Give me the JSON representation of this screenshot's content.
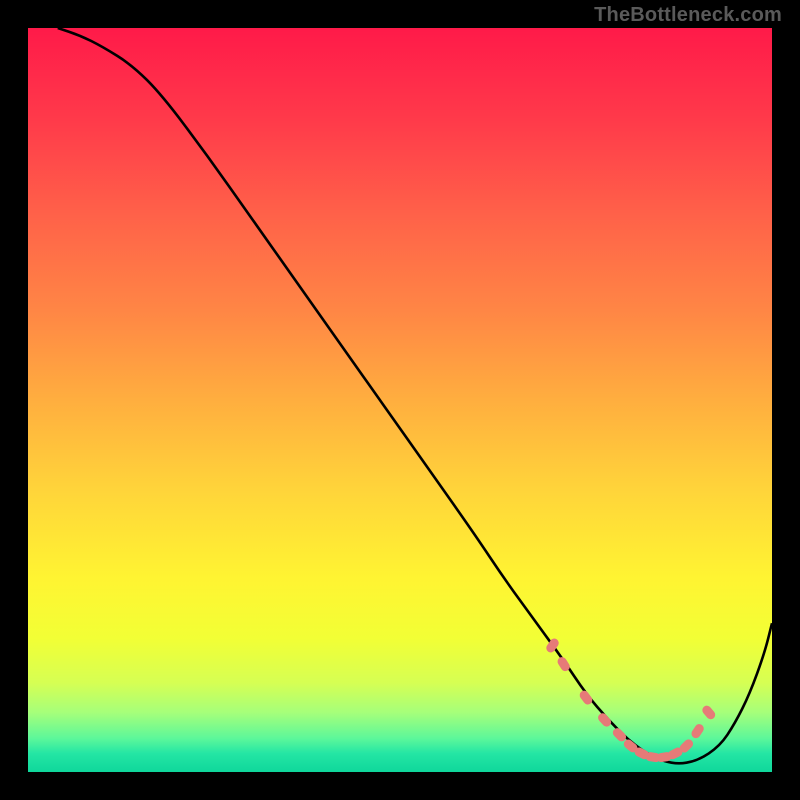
{
  "watermark": "TheBottleneck.com",
  "colors": {
    "background": "#000000",
    "curve": "#000000",
    "markers": "#e67a78",
    "gradient_stops": [
      {
        "offset": 0.0,
        "color": "#ff1a49"
      },
      {
        "offset": 0.12,
        "color": "#ff394a"
      },
      {
        "offset": 0.25,
        "color": "#ff6149"
      },
      {
        "offset": 0.38,
        "color": "#ff8645"
      },
      {
        "offset": 0.5,
        "color": "#ffae3f"
      },
      {
        "offset": 0.62,
        "color": "#ffd43a"
      },
      {
        "offset": 0.74,
        "color": "#fff432"
      },
      {
        "offset": 0.82,
        "color": "#f2ff35"
      },
      {
        "offset": 0.88,
        "color": "#d6ff53"
      },
      {
        "offset": 0.92,
        "color": "#a6ff7a"
      },
      {
        "offset": 0.955,
        "color": "#5cf79a"
      },
      {
        "offset": 0.975,
        "color": "#24e6a4"
      },
      {
        "offset": 1.0,
        "color": "#0fd79b"
      }
    ]
  },
  "chart_data": {
    "type": "line",
    "title": "",
    "xlabel": "",
    "ylabel": "",
    "xlim": [
      0,
      100
    ],
    "ylim": [
      0,
      100
    ],
    "grid": false,
    "legend": false,
    "series": [
      {
        "name": "curve",
        "x": [
          4,
          7,
          10,
          14,
          18,
          24,
          30,
          36,
          42,
          48,
          54,
          60,
          64,
          68,
          72,
          75,
          78,
          81,
          84,
          87,
          90,
          93,
          95,
          97,
          99,
          100
        ],
        "y": [
          100,
          99,
          97.5,
          95,
          91,
          83,
          74.5,
          66,
          57.5,
          49,
          40.5,
          32,
          26,
          20.5,
          15,
          10.5,
          7,
          4,
          2,
          1,
          1.5,
          3.5,
          6.5,
          10.5,
          16,
          20
        ]
      }
    ],
    "markers": {
      "name": "dots",
      "x": [
        70.5,
        72,
        75,
        77.5,
        79.5,
        81,
        82.5,
        84,
        85.5,
        87,
        88.5,
        90,
        91.5
      ],
      "y": [
        17,
        14.5,
        10,
        7,
        5,
        3.5,
        2.5,
        2,
        2,
        2.5,
        3.5,
        5.5,
        8
      ]
    }
  }
}
